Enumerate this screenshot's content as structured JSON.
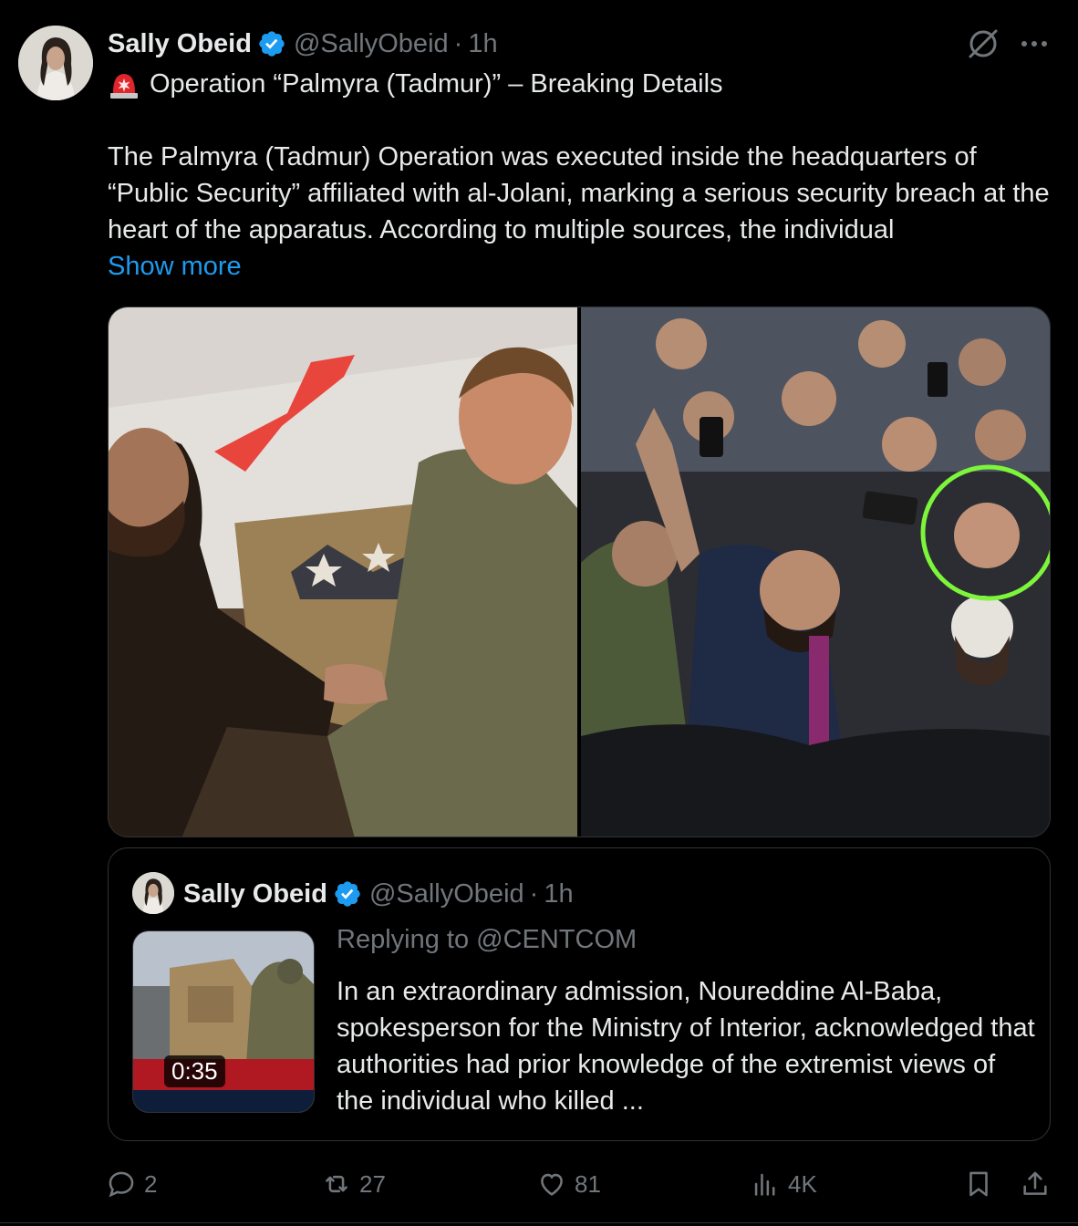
{
  "post": {
    "author_name": "Sally Obeid",
    "author_handle": "@SallyObeid",
    "separator": "·",
    "time": "1h",
    "headline": "Operation “Palmyra (Tadmur)” – Breaking Details",
    "body": "The Palmyra (Tadmur) Operation was executed inside the headquarters of “Public Security” affiliated with al-Jolani, marking a serious security breach at the heart of the apparatus. According to multiple sources, the individual",
    "show_more": "Show more"
  },
  "quoted_post": {
    "author_name": "Sally Obeid",
    "author_handle": "@SallyObeid",
    "separator": "·",
    "time": "1h",
    "replying_to": "Replying to @CENTCOM",
    "video_duration": "0:35",
    "text": "In an extraordinary admission, Noureddine Al-Baba, spokesperson for the Ministry of Interior, acknowledged that authorities had prior knowledge of the extremist views of the individual who killed ..."
  },
  "actions": {
    "replies": "2",
    "reposts": "27",
    "likes": "81",
    "views": "4K"
  },
  "colors": {
    "background": "#000000",
    "text_primary": "#e7e9ea",
    "text_secondary": "#71767b",
    "link": "#1d9bf0",
    "verified": "#1d9bf0",
    "border": "#2f3336",
    "highlight_circle": "#7cf53a",
    "arrow": "#e8453c"
  },
  "icons": [
    "verified-badge-icon",
    "grok-icon",
    "more-icon",
    "siren-emoji",
    "reply-icon",
    "repost-icon",
    "like-icon",
    "views-icon",
    "bookmark-icon",
    "share-icon"
  ]
}
